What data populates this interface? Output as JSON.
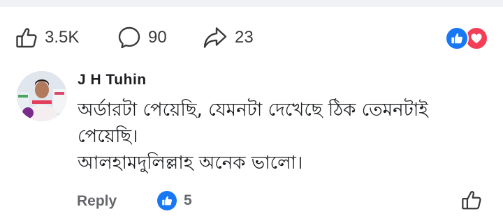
{
  "post_actions": {
    "likes_count": "3.5K",
    "comments_count": "90",
    "shares_count": "23",
    "reaction_icons": [
      "like-icon",
      "love-icon"
    ],
    "colors": {
      "like_blue": "#1877f2",
      "love_red": "#f33e58",
      "muted_text": "#65676b"
    }
  },
  "comment": {
    "author": "J H Tuhin",
    "lines": [
      "অর্ডারটা পেয়েছি, যেমনটা দেখেছে ঠিক তেমনটাই",
      "পেয়েছি।",
      "আলহামদুলিল্লাহ অনেক ভালো।"
    ],
    "reply_label": "Reply",
    "like_count": "5"
  }
}
